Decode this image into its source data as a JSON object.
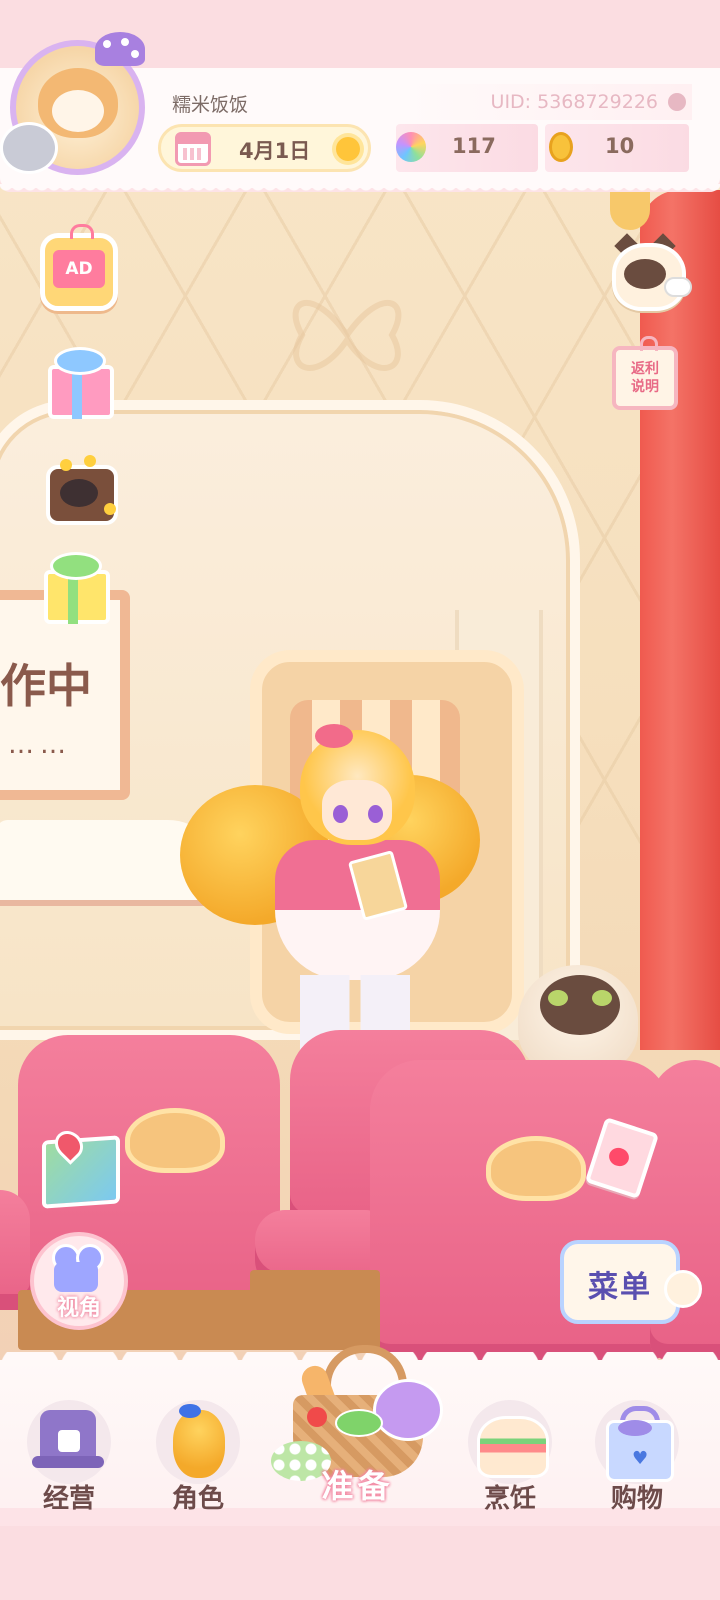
{
  "header": {
    "player_name": "糯米饭饭",
    "uid": "UID: 5368729226",
    "date": "4月1日",
    "currency_gems": "117",
    "currency_coins": "10"
  },
  "side_left": {
    "ad_label": "AD"
  },
  "side_right": {
    "rebate_label": "返利说明",
    "menu_label": "菜单"
  },
  "scene": {
    "sign_text": "作中",
    "sign_dots": "……"
  },
  "camera_label": "视角",
  "bottom_nav": {
    "items": [
      {
        "label": "经营"
      },
      {
        "label": "角色"
      },
      {
        "label": "准备"
      },
      {
        "label": "烹饪"
      },
      {
        "label": "购物"
      }
    ]
  },
  "colors": {
    "accent_pink": "#f286a1",
    "curtain_red": "#f05a4f",
    "seat_pink": "#e86186",
    "text_brown": "#6d4b4a"
  },
  "icons": [
    "avatar",
    "calendar-icon",
    "sun-icon",
    "rainbow-flower-icon",
    "coin-icon",
    "ad-tv-icon",
    "gift-icon",
    "raccoon-chest-icon",
    "map-icon",
    "camera-icon",
    "cat-chat-icon",
    "recipe-icon",
    "menu-book-icon"
  ]
}
